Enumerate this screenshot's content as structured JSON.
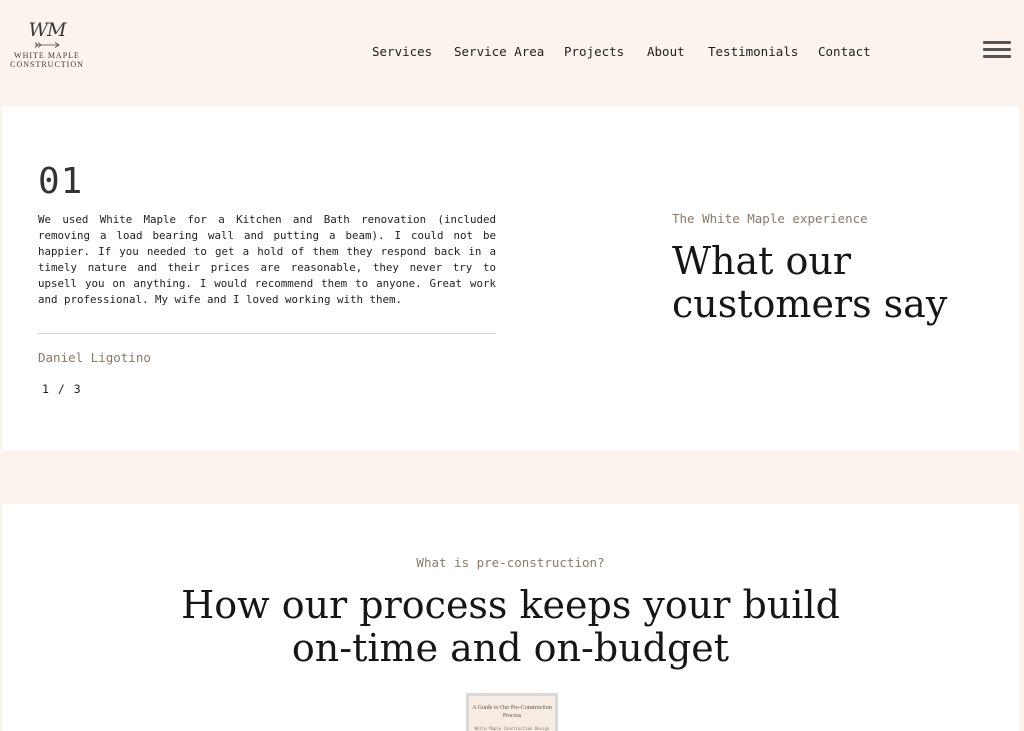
{
  "brand": {
    "mark": "WM",
    "name_line1": "WHITE MAPLE",
    "name_line2": "CONSTRUCTION"
  },
  "nav": {
    "items": [
      {
        "label": "Services"
      },
      {
        "label": "Service Area"
      },
      {
        "label": "Projects"
      },
      {
        "label": "About"
      },
      {
        "label": "Testimonials"
      },
      {
        "label": "Contact"
      }
    ],
    "menu_icon": "hamburger-menu-icon"
  },
  "testimonials": {
    "number": "01",
    "quote": "We used White Maple for a Kitchen and Bath renovation (included removing a load bearing wall and putting a beam). I could not be happier. If you needed to get a hold of them they respond back in a timely nature and their prices are reasonable, they never try to upsell you on anything. I would recommend them to anyone. Great work and professional. My wife and I loved working with them.",
    "author": "Daniel Ligotino",
    "counter": "1 / 3",
    "eyebrow": "The White Maple experience",
    "heading": "What our customers say"
  },
  "preconstruction": {
    "eyebrow": "What is pre-construction?",
    "heading_line1": "How our process keeps your build",
    "heading_line2": "on-time and on-budget",
    "booklet_title": "A Guide to Our Pre-Construction Process",
    "booklet_subtitle": "White Maple Construction Design"
  },
  "colors": {
    "background": "#fbf3ec",
    "card": "#ffffff",
    "accent_text": "#8a7a6a"
  }
}
